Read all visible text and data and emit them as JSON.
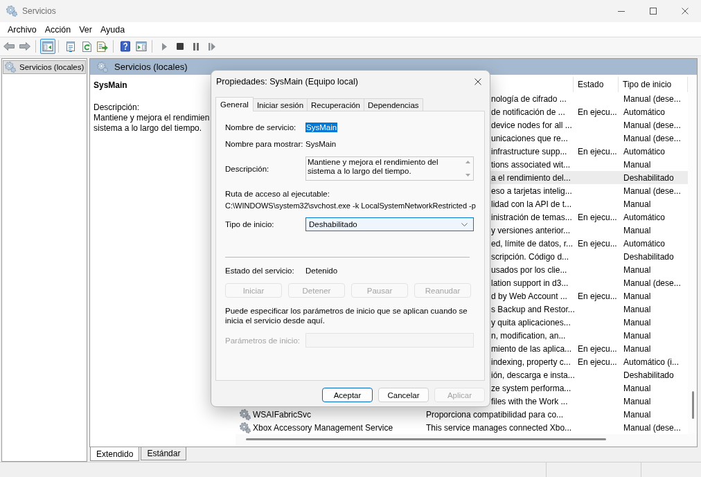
{
  "window": {
    "title": "Servicios"
  },
  "menu": [
    {
      "label": "Archivo"
    },
    {
      "label": "Acción"
    },
    {
      "label": "Ver"
    },
    {
      "label": "Ayuda"
    }
  ],
  "toolbar": {
    "groups": [
      [
        {
          "kind": "back",
          "pressed": false
        },
        {
          "kind": "forward",
          "pressed": false
        }
      ],
      [
        {
          "kind": "console_tree",
          "pressed": true
        }
      ],
      [
        {
          "kind": "properties",
          "pressed": false
        },
        {
          "kind": "refresh",
          "pressed": false
        },
        {
          "kind": "export",
          "pressed": false
        }
      ],
      [
        {
          "kind": "help",
          "pressed": false
        },
        {
          "kind": "action_pane",
          "pressed": false
        }
      ],
      [
        {
          "kind": "start",
          "pressed": false
        },
        {
          "kind": "stop",
          "pressed": false
        },
        {
          "kind": "pause",
          "pressed": false
        },
        {
          "kind": "restart",
          "pressed": false
        }
      ]
    ]
  },
  "tree": {
    "items": [
      {
        "label": "Servicios (locales)",
        "selected": true
      }
    ]
  },
  "services_pane": {
    "header": "Servicios (locales)",
    "detail": {
      "title": "SysMain",
      "description_label": "Descripción:",
      "description_lines": [
        "Mantiene y mejora el rendimien",
        "sistema a lo largo del tiempo."
      ]
    },
    "columns": [
      {
        "label": "Estado"
      },
      {
        "label": "Tipo de inicio"
      }
    ],
    "rows": [
      {
        "description": "nología de cifrado ...",
        "startup_type": "Manual (dese...",
        "selected": false
      },
      {
        "description": "de notificación de ...",
        "status": "En ejecu...",
        "startup_type": "Automático",
        "selected": false
      },
      {
        "description": "device nodes for all ...",
        "startup_type": "Manual (dese...",
        "selected": false
      },
      {
        "description": "unicaciones que re...",
        "startup_type": "Manual (dese...",
        "selected": false
      },
      {
        "description": "infrastructure supp...",
        "status": "En ejecu...",
        "startup_type": "Automático",
        "selected": false
      },
      {
        "description": "tions associated wit...",
        "startup_type": "Manual",
        "selected": false
      },
      {
        "description": "a el rendimiento del...",
        "startup_type": "Deshabilitado",
        "selected": true
      },
      {
        "description": "eso a tarjetas intelig...",
        "startup_type": "Manual (dese...",
        "selected": false
      },
      {
        "description": "lidad con la API de t...",
        "startup_type": "Manual",
        "selected": false
      },
      {
        "description": "inistración de temas...",
        "status": "En ejecu...",
        "startup_type": "Automático",
        "selected": false
      },
      {
        "description": "y versiones anterior...",
        "startup_type": "Manual",
        "selected": false
      },
      {
        "description": "ed, límite de datos, r...",
        "status": "En ejecu...",
        "startup_type": "Automático",
        "selected": false
      },
      {
        "description": "scripción. Código d...",
        "startup_type": "Deshabilitado",
        "selected": false
      },
      {
        "description": "usados por los clie...",
        "startup_type": "Manual",
        "selected": false
      },
      {
        "description": "lation support in d3...",
        "startup_type": "Manual (dese...",
        "selected": false
      },
      {
        "description": "d by Web Account ...",
        "status": "En ejecu...",
        "startup_type": "Manual",
        "selected": false
      },
      {
        "description": "s Backup and Restor...",
        "startup_type": "Manual",
        "selected": false
      },
      {
        "description": "y quita aplicaciones...",
        "startup_type": "Manual",
        "selected": false
      },
      {
        "description": "n, modification, an...",
        "startup_type": "Manual",
        "selected": false
      },
      {
        "description": "miento de las aplica...",
        "status": "En ejecu...",
        "startup_type": "Manual",
        "selected": false
      },
      {
        "description": "indexing, property c...",
        "status": "En ejecu...",
        "startup_type": "Automático (i...",
        "selected": false
      },
      {
        "description": "ión, descarga e insta...",
        "startup_type": "Deshabilitado",
        "selected": false
      },
      {
        "description": "ze system performa...",
        "startup_type": "Manual",
        "selected": false
      },
      {
        "description": "files with the Work ...",
        "startup_type": "Manual",
        "selected": false
      },
      {
        "name": "WSAIFabricSvc",
        "description": "Proporciona compatibilidad para co...",
        "startup_type": "Manual",
        "selected": false
      },
      {
        "name": "Xbox Accessory Management Service",
        "description": "This service manages connected Xbo...",
        "startup_type": "Manual (dese...",
        "selected": false
      }
    ],
    "tabs": [
      {
        "label": "Extendido",
        "selected": true
      },
      {
        "label": "Estándar",
        "selected": false
      }
    ]
  },
  "dialog": {
    "title": "Propiedades: SysMain (Equipo local)",
    "tabs": [
      {
        "label": "General",
        "selected": true
      },
      {
        "label": "Iniciar sesión",
        "selected": false
      },
      {
        "label": "Recuperación",
        "selected": false
      },
      {
        "label": "Dependencias",
        "selected": false
      }
    ],
    "service_name": {
      "label": "Nombre de servicio:",
      "value": "SysMain",
      "text_selected": true
    },
    "display_name": {
      "label": "Nombre para mostrar:",
      "value": "SysMain"
    },
    "description": {
      "label": "Descripción:",
      "value": "Mantiene y mejora el rendimiento del sistema a lo largo del tiempo."
    },
    "executable_path": {
      "label": "Ruta de acceso al ejecutable:",
      "value": "C:\\WINDOWS\\system32\\svchost.exe -k LocalSystemNetworkRestricted -p"
    },
    "startup_type": {
      "label": "Tipo de inicio:",
      "value": "Deshabilitado",
      "focused": true
    },
    "service_status": {
      "label": "Estado del servicio:",
      "value": "Detenido"
    },
    "service_buttons": [
      {
        "label": "Iniciar",
        "disabled": true
      },
      {
        "label": "Detener",
        "disabled": true
      },
      {
        "label": "Pausar",
        "disabled": true
      },
      {
        "label": "Reanudar",
        "disabled": true
      }
    ],
    "note": "Puede especificar los parámetros de inicio que se aplican cuando se inicia el servicio desde aquí.",
    "start_parameters": {
      "label": "Parámetros de inicio:",
      "disabled": true
    },
    "buttons": [
      {
        "label": "Aceptar",
        "default": true,
        "disabled": false
      },
      {
        "label": "Cancelar",
        "default": false,
        "disabled": false
      },
      {
        "label": "Aplicar",
        "default": false,
        "disabled": true
      }
    ]
  }
}
